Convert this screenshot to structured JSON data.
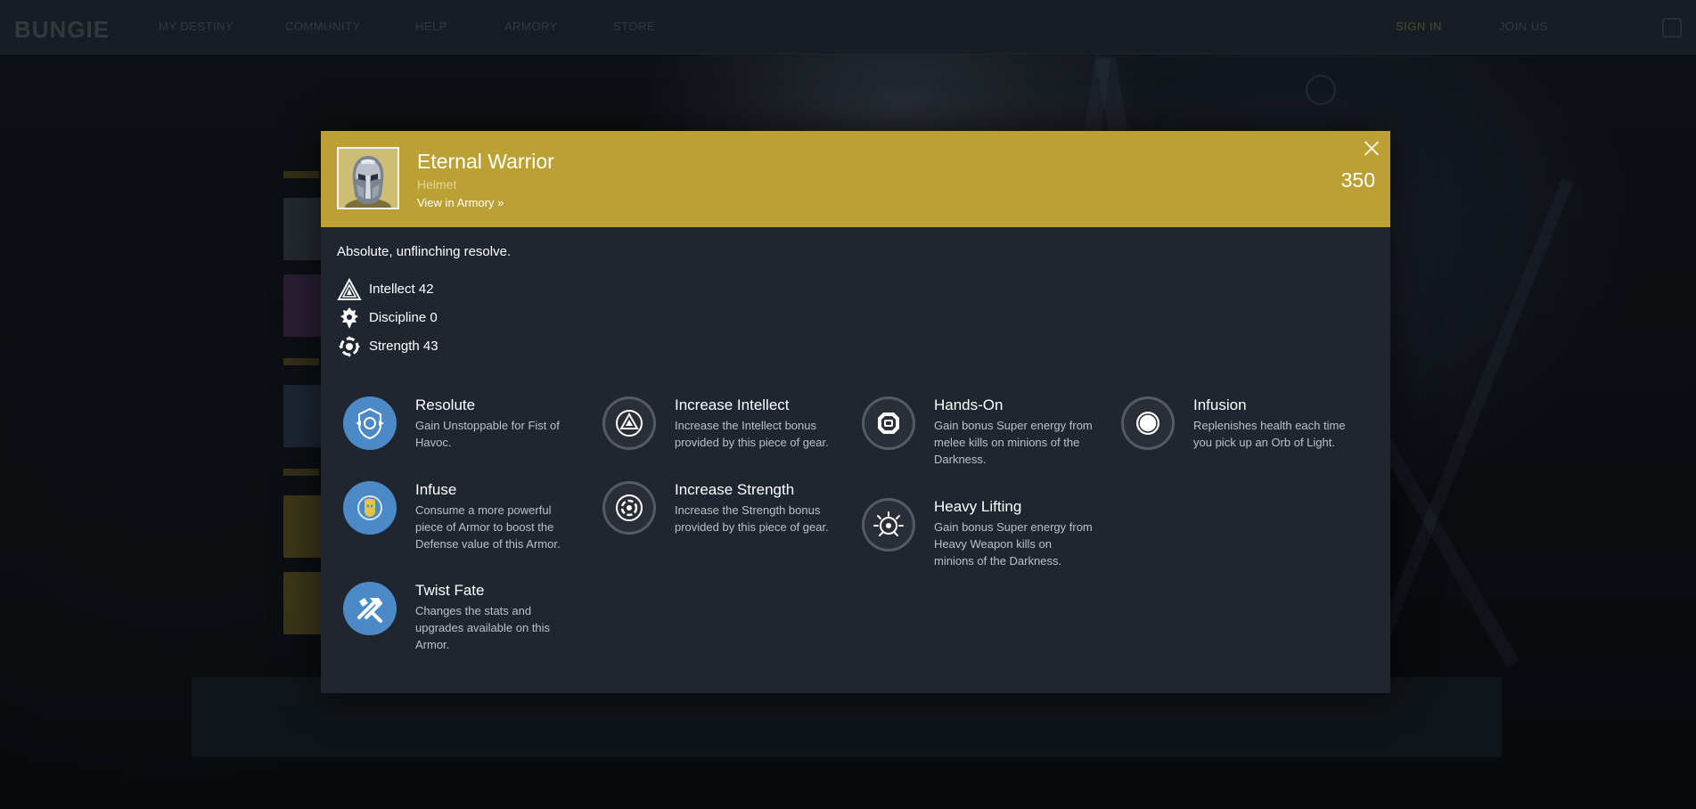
{
  "background_page": {
    "nav_items": [
      "MY DESTINY",
      "COMMUNITY",
      "HELP",
      "ARMORY",
      "STORE"
    ],
    "nav_user_items": [
      "SIGN IN",
      "JOIN US"
    ]
  },
  "item": {
    "name": "Eternal Warrior",
    "type": "Helmet",
    "armory_link": "View in Armory »",
    "light": "350",
    "description": "Absolute, unflinching resolve.",
    "header_color": "#bba033"
  },
  "stats": [
    {
      "icon": "intellect-icon",
      "label": "Intellect 42"
    },
    {
      "icon": "discipline-icon",
      "label": "Discipline 0"
    },
    {
      "icon": "strength-icon",
      "label": "Strength 43"
    }
  ],
  "perks": {
    "column_1": [
      {
        "icon": "resolute-icon",
        "name": "Resolute",
        "desc": "Gain Unstoppable for Fist of Havoc.",
        "style": "blue"
      },
      {
        "icon": "infuse-icon",
        "name": "Infuse",
        "desc": "Consume a more powerful piece of Armor to boost the Defense value of this Armor.",
        "style": "blue"
      },
      {
        "icon": "twist-fate-icon",
        "name": "Twist Fate",
        "desc": "Changes the stats and upgrades available on this Armor.",
        "style": "blue"
      }
    ],
    "column_2": [
      {
        "icon": "increase-intellect-icon",
        "name": "Increase Intellect",
        "desc": "Increase the Intellect bonus provided by this piece of gear.",
        "style": "dark"
      },
      {
        "icon": "increase-strength-icon",
        "name": "Increase Strength",
        "desc": "Increase the Strength bonus provided by this piece of gear.",
        "style": "dark"
      }
    ],
    "column_3": [
      {
        "icon": "hands-on-icon",
        "name": "Hands-On",
        "desc": "Gain bonus Super energy from melee kills on minions of the Darkness.",
        "style": "dark"
      },
      {
        "icon": "heavy-lifting-icon",
        "name": "Heavy Lifting",
        "desc": "Gain bonus Super energy from Heavy Weapon kills on minions of the Darkness.",
        "style": "dark"
      }
    ],
    "column_4": [
      {
        "icon": "infusion-icon",
        "name": "Infusion",
        "desc": "Replenishes health each time you pick up an Orb of Light.",
        "style": "dark"
      }
    ]
  }
}
